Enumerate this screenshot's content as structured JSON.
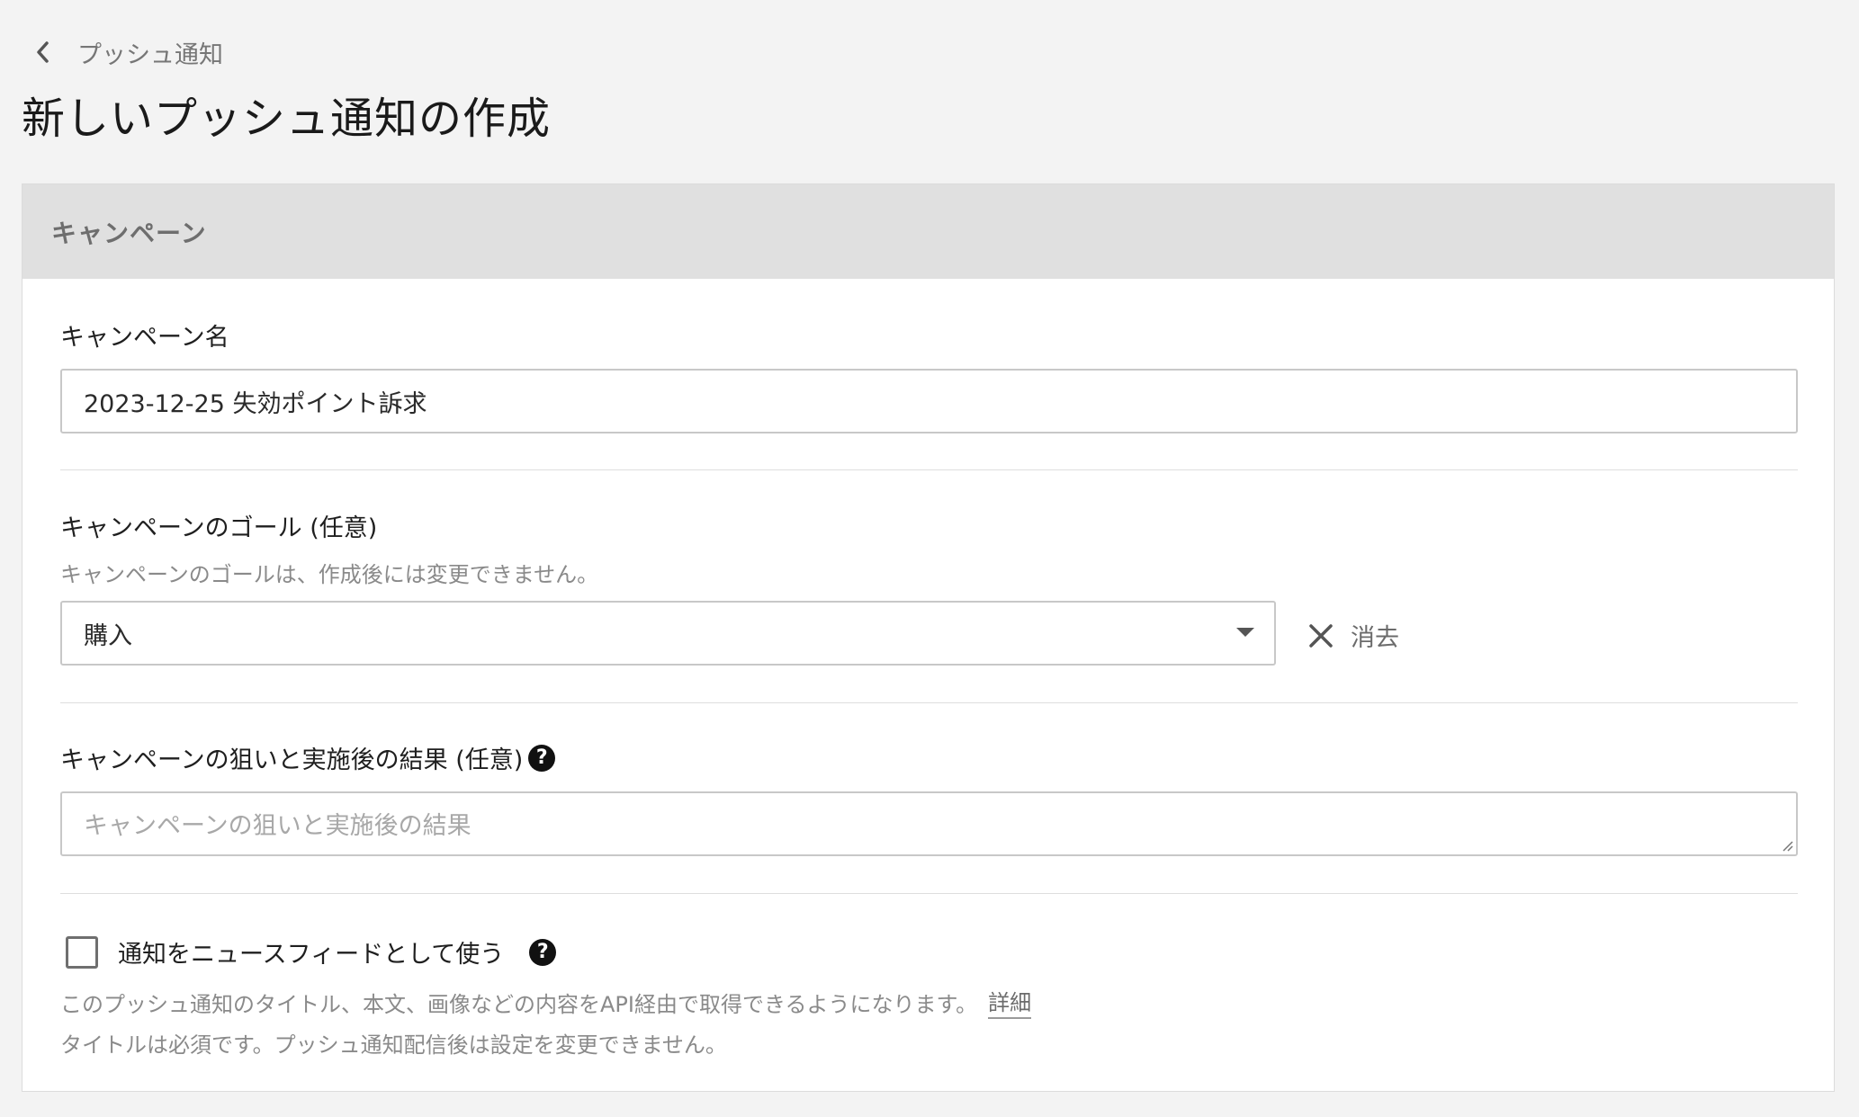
{
  "breadcrumb": {
    "back_icon": "chevron-left-icon",
    "label": "プッシュ通知"
  },
  "page": {
    "title": "新しいプッシュ通知の作成"
  },
  "campaign_section": {
    "header": "キャンペーン",
    "name_field": {
      "label": "キャンペーン名",
      "value": "2023-12-25 失効ポイント訴求"
    },
    "goal_field": {
      "label": "キャンペーンのゴール (任意)",
      "help": "キャンペーンのゴールは、作成後には変更できません。",
      "selected": "購入",
      "clear_label": "消去",
      "clear_icon": "close-icon",
      "caret_icon": "caret-down-icon"
    },
    "aim_field": {
      "label": "キャンペーンの狙いと実施後の結果 (任意)",
      "help_icon": "question-circle-icon",
      "placeholder": "キャンペーンの狙いと実施後の結果"
    },
    "newsfeed": {
      "checkbox_label": "通知をニュースフィードとして使う",
      "checked": false,
      "help_icon": "question-circle-icon",
      "note1": "このプッシュ通知のタイトル、本文、画像などの内容をAPI経由で取得できるようになります。",
      "detail_link": "詳細",
      "note2": "タイトルは必須です。プッシュ通知配信後は設定を変更できません。"
    }
  },
  "colors": {
    "page_bg": "#f3f3f3",
    "card_header_bg": "#e0e0e0",
    "border": "#c8c8c8",
    "muted_text": "#8a8a8a"
  }
}
